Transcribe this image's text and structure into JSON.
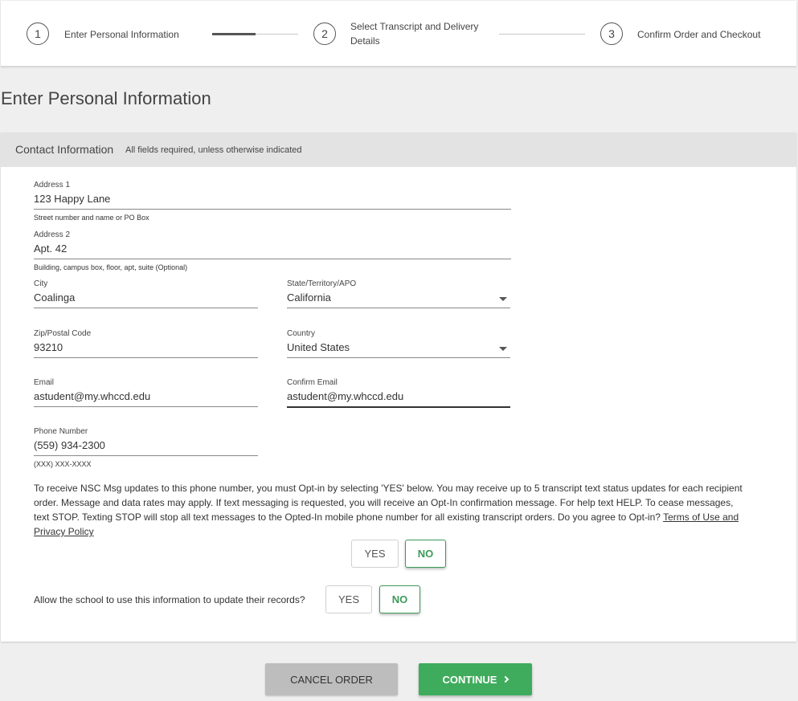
{
  "stepper": {
    "steps": [
      {
        "number": "1",
        "label": "Enter Personal Information"
      },
      {
        "number": "2",
        "label_line1": "Select Transcript and Delivery",
        "label_line2": "Details"
      },
      {
        "number": "3",
        "label": "Confirm Order and Checkout"
      }
    ],
    "current_step": 1,
    "progress_fraction": 0.5
  },
  "page": {
    "title": "Enter Personal Information"
  },
  "contact": {
    "title": "Contact Information",
    "note": "All fields required, unless otherwise indicated",
    "address1": {
      "label": "Address 1",
      "value": "123 Happy Lane",
      "hint": "Street number and name or PO Box"
    },
    "address2": {
      "label": "Address 2",
      "value": "Apt. 42",
      "hint": "Building, campus box, floor, apt, suite (Optional)"
    },
    "city": {
      "label": "City",
      "value": "Coalinga"
    },
    "state": {
      "label": "State/Territory/APO",
      "value": "California"
    },
    "zip": {
      "label": "Zip/Postal Code",
      "value": "93210"
    },
    "country": {
      "label": "Country",
      "value": "United States"
    },
    "email": {
      "label": "Email",
      "value": "astudent@my.whccd.edu"
    },
    "confirm_email": {
      "label": "Confirm Email",
      "value": "astudent@my.whccd.edu"
    },
    "phone": {
      "label": "Phone Number",
      "value": "(559) 934-2300",
      "hint": "(XXX) XXX-XXXX"
    },
    "optin": {
      "text": "To receive NSC Msg updates to this phone number, you must Opt-in by selecting 'YES' below. You may receive up to 5 transcript text status updates for each recipient order. Message and data rates may apply. If text messaging is requested, you will receive an Opt-In confirmation message. For help text HELP. To cease messages, text STOP. Texting STOP will stop all text messages to the Opted-In mobile phone number for all existing transcript orders. Do you agree to Opt-in?",
      "link": "Terms of Use and Privacy Policy",
      "yes_label": "YES",
      "no_label": "NO",
      "selected": "NO"
    },
    "records": {
      "question": "Allow the school to use this information to update their records?",
      "yes_label": "YES",
      "no_label": "NO",
      "selected": "NO"
    }
  },
  "actions": {
    "cancel_label": "CANCEL ORDER",
    "continue_label": "CONTINUE"
  },
  "colors": {
    "accent_green": "#3eac5c",
    "selected_green": "#3d9a58",
    "cancel_gray": "#bdbdbd"
  }
}
